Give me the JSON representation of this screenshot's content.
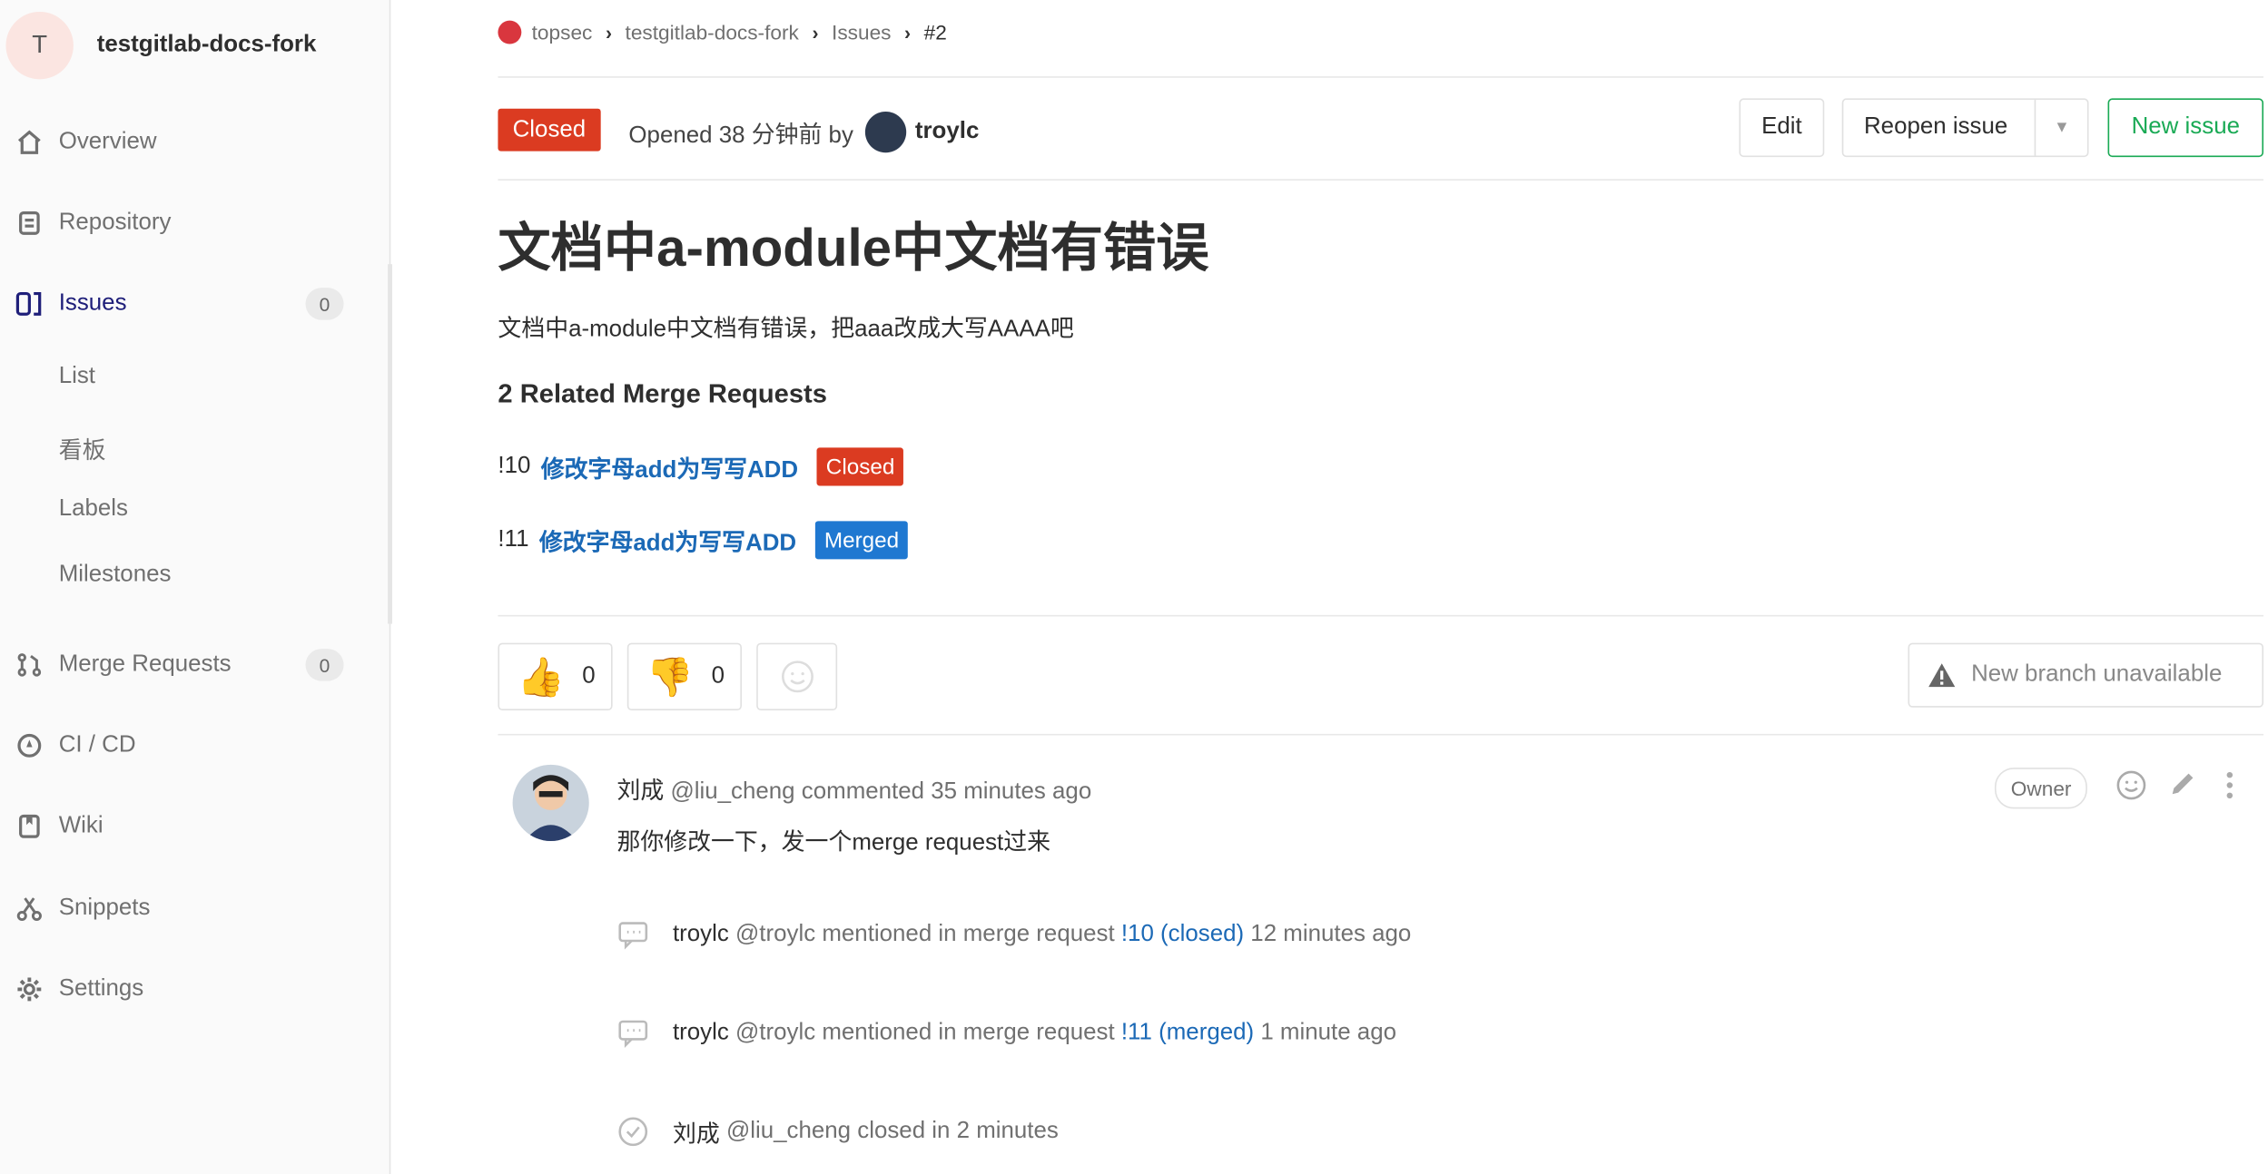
{
  "project": {
    "avatar_letter": "T",
    "name": "testgitlab-docs-fork"
  },
  "sidebar": {
    "overview": "Overview",
    "repository": "Repository",
    "issues": "Issues",
    "issues_count": "0",
    "sub_list": "List",
    "sub_board": "看板",
    "sub_labels": "Labels",
    "sub_milestones": "Milestones",
    "merge_requests": "Merge Requests",
    "merge_requests_count": "0",
    "cicd": "CI / CD",
    "wiki": "Wiki",
    "snippets": "Snippets",
    "settings": "Settings"
  },
  "breadcrumb": {
    "group": "topsec",
    "project": "testgitlab-docs-fork",
    "section": "Issues",
    "current": "#2"
  },
  "issue": {
    "status": "Closed",
    "opened_text": "Opened 38 分钟前 by",
    "author": "troylc",
    "title": "文档中a-module中文档有错误",
    "description": "文档中a-module中文档有错误，把aaa改成大写AAAA吧"
  },
  "buttons": {
    "edit": "Edit",
    "reopen": "Reopen issue",
    "new_issue": "New issue",
    "new_branch": "New branch unavailable"
  },
  "related": {
    "heading": "2 Related Merge Requests",
    "items": [
      {
        "ref": "!10",
        "title": "修改字母add为写写ADD",
        "state": "Closed",
        "color": "#db3b21"
      },
      {
        "ref": "!11",
        "title": "修改字母add为写写ADD",
        "state": "Merged",
        "color": "#1f78d1"
      }
    ]
  },
  "awards": {
    "thumbs_up": "0",
    "thumbs_down": "0"
  },
  "comment": {
    "author_name": "刘成",
    "author_handle": "@liu_cheng",
    "action": "commented",
    "time": "35 minutes ago",
    "role": "Owner",
    "body": "那你修改一下，发一个merge request过来"
  },
  "system_notes": [
    {
      "name": "troylc",
      "handle": "@troylc",
      "text": "mentioned in merge request",
      "link": "!10 (closed)",
      "time": "12 minutes ago"
    },
    {
      "name": "troylc",
      "handle": "@troylc",
      "text": "mentioned in merge request",
      "link": "!11 (merged)",
      "time": "1 minute ago"
    },
    {
      "name": "刘成",
      "handle": "@liu_cheng",
      "text": "closed in 2 minutes",
      "link": "",
      "time": ""
    }
  ]
}
